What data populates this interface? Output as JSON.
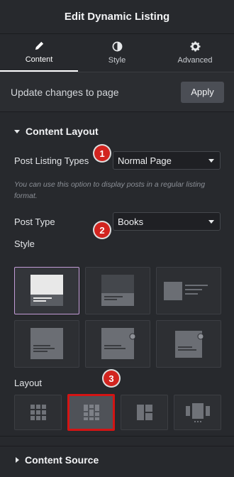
{
  "header": {
    "title": "Edit Dynamic Listing"
  },
  "tabs": [
    {
      "label": "Content",
      "icon": "pencil-icon",
      "active": true
    },
    {
      "label": "Style",
      "icon": "half-circle-icon",
      "active": false
    },
    {
      "label": "Advanced",
      "icon": "gear-icon",
      "active": false
    }
  ],
  "update": {
    "text": "Update changes to page",
    "button": "Apply"
  },
  "content_layout": {
    "title": "Content Layout",
    "post_listing_types": {
      "label": "Post Listing Types",
      "value": "Normal Page"
    },
    "help": "You can use this option to display posts in a regular listing format.",
    "post_type": {
      "label": "Post Type",
      "value": "Books"
    },
    "style_label": "Style",
    "layout_label": "Layout"
  },
  "badges": {
    "one": "1",
    "two": "2",
    "three": "3"
  },
  "content_source": {
    "title": "Content Source"
  },
  "colors": {
    "background": "#27292d",
    "badge": "#d2241f",
    "selected_style_border": "#c29bd6",
    "selected_layout_border": "#d31414"
  }
}
